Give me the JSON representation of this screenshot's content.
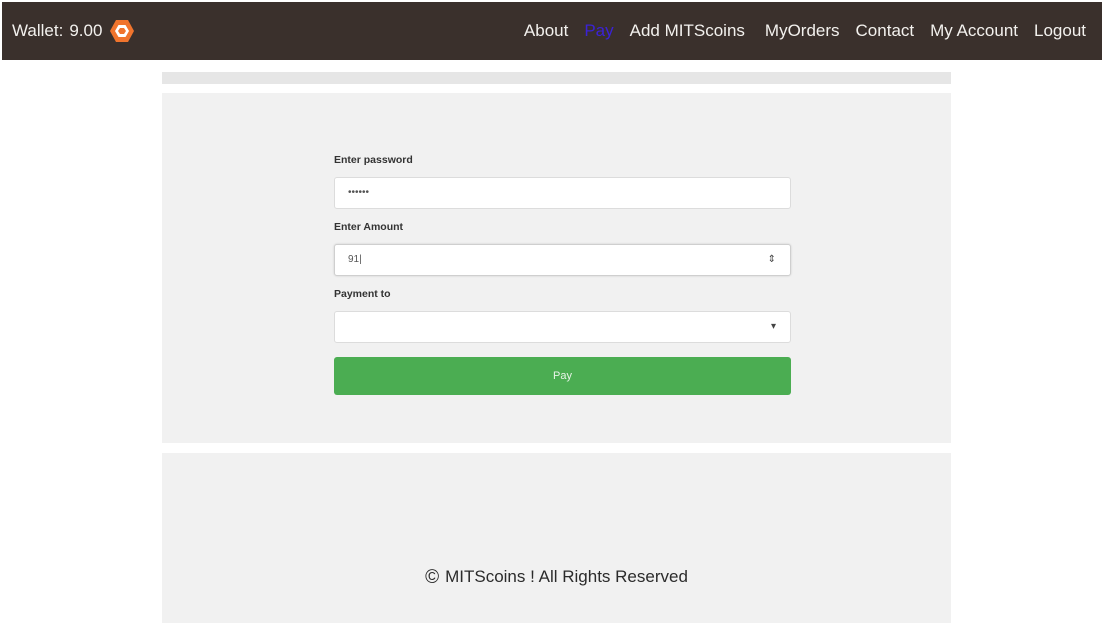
{
  "header": {
    "wallet_label": "Wallet:",
    "wallet_value": "9.00",
    "coin_icon": "hexagon-coin-icon",
    "coin_color": "#f0742d",
    "nav": [
      {
        "label": "About"
      },
      {
        "label": "Pay",
        "active": true
      },
      {
        "label": "Add MITScoins"
      },
      {
        "label": "MyOrders"
      },
      {
        "label": "Contact"
      },
      {
        "label": "My Account"
      },
      {
        "label": "Logout"
      }
    ],
    "bar_color": "#3a302c",
    "active_color": "#3b22d6"
  },
  "form": {
    "password_label": "Enter password",
    "password_value": "••••••",
    "amount_label": "Enter Amount",
    "amount_value": "91|",
    "payment_to_label": "Payment to",
    "payment_to_value": "",
    "pay_button": "Pay",
    "button_color": "#4bad52"
  },
  "footer": {
    "copyright_symbol": "©",
    "text": "MITScoins ! All Rights Reserved"
  }
}
